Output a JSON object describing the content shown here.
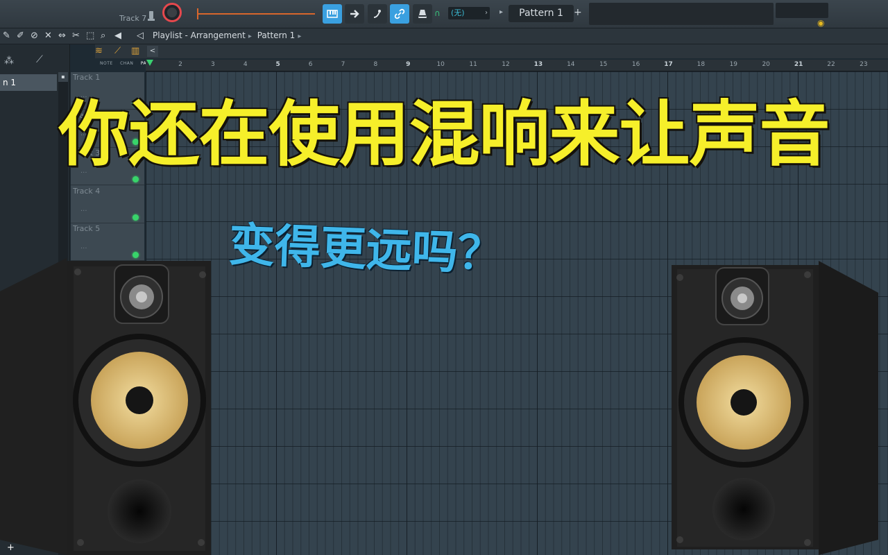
{
  "topbar": {
    "track_hint": "Track 7",
    "headphone_icon": "headphone-icon",
    "none_label": "(无)",
    "pattern_label": "Pattern 1",
    "plus": "+"
  },
  "breadcrumb": {
    "items": [
      "Playlist - Arrangement",
      "Pattern 1"
    ]
  },
  "left_panel": {
    "selected_item": "n 1",
    "add_label": "+"
  },
  "playlist": {
    "labels": [
      "NOTE",
      "CHAN",
      "PAT"
    ],
    "ruler": [
      "2",
      "3",
      "4",
      "5",
      "6",
      "7",
      "8",
      "9",
      "10",
      "11",
      "12",
      "13",
      "14",
      "15",
      "16",
      "17",
      "18",
      "19",
      "20",
      "21",
      "22",
      "23"
    ],
    "tracks": [
      "Track 1",
      "Track 2",
      "Track 3",
      "Track 4",
      "Track 5"
    ],
    "track_dots": "..."
  },
  "overlay": {
    "title": "你还在使用混响来让声音",
    "subtitle": "变得更远吗？"
  },
  "colors": {
    "title": "#f6ef2a",
    "subtitle": "#3fb6ea",
    "accent_blue": "#3aa0e0",
    "led_green": "#38d46a",
    "knob_red": "#e5484d",
    "cone_yellow": "#e0c276"
  }
}
